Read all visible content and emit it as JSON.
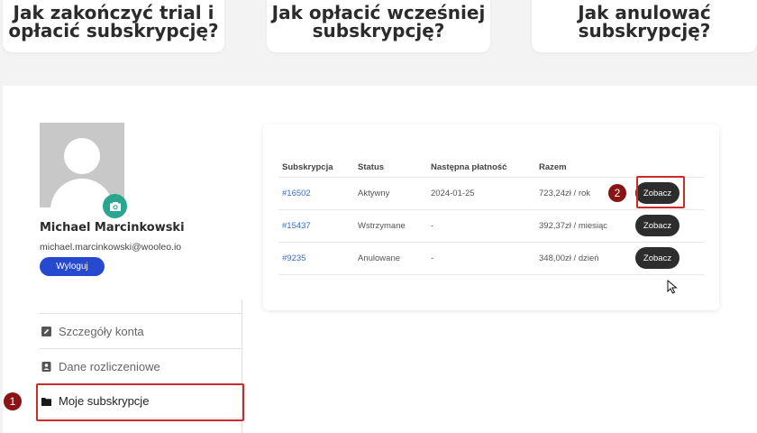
{
  "faq": [
    {
      "title": "Jak zakończyć trial i opłacić subskrypcję?"
    },
    {
      "title": "Jak opłacić wcześniej subskrypcję?"
    },
    {
      "title": "Jak anulować subskrypcję?"
    }
  ],
  "user": {
    "name": "Michael Marcinkowski",
    "email": "michael.marcinkowski@wooleo.io",
    "logout_label": "Wyloguj"
  },
  "menu": {
    "items": [
      {
        "label": "Szczegóły konta",
        "icon": "edit-icon"
      },
      {
        "label": "Dane rozliczeniowe",
        "icon": "contact-card-icon"
      },
      {
        "label": "Moje subskrypcje",
        "icon": "folder-icon"
      }
    ]
  },
  "subscriptions": {
    "headers": [
      "Subskrypcja",
      "Status",
      "Następna płatność",
      "Razem"
    ],
    "rows": [
      {
        "id": "#16502",
        "status": "Aktywny",
        "next_payment": "2024-01-25",
        "total": "723,24zł / rok",
        "action": "Zobacz"
      },
      {
        "id": "#15437",
        "status": "Wstrzymane",
        "next_payment": "-",
        "total": "392,37zł / miesiąc",
        "action": "Zobacz"
      },
      {
        "id": "#9235",
        "status": "Anulowane",
        "next_payment": "-",
        "total": "348,00zł / dzień",
        "action": "Zobacz"
      }
    ]
  },
  "annotations": {
    "step1": "1",
    "step2": "2"
  },
  "colors": {
    "accent_blue": "#2649d0",
    "camera_green": "#2aa58e",
    "highlight_red": "#cc2b2b",
    "step_badge": "#8a1414",
    "link_blue": "#3a6fc4"
  }
}
